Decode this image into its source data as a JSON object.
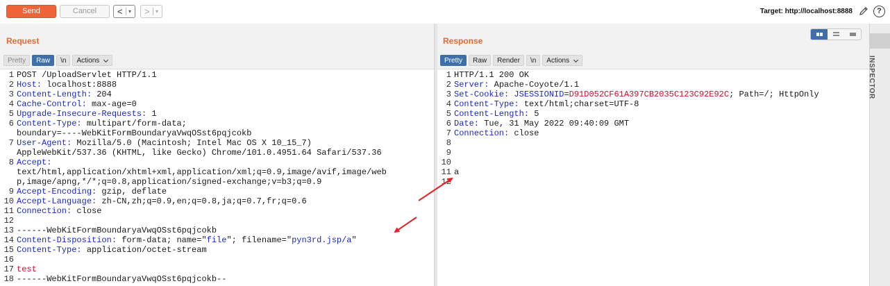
{
  "toolbar": {
    "send_label": "Send",
    "cancel_label": "Cancel",
    "back_glyph": "<",
    "fwd_glyph": ">",
    "dropdown_glyph": "▾",
    "target_label": "Target: http://localhost:8888",
    "help_glyph": "?",
    "icons": [
      "edit-icon",
      "help-icon"
    ]
  },
  "request": {
    "title": "Request",
    "tabs": {
      "pretty": "Pretty",
      "raw": "Raw",
      "newline": "\\n",
      "actions": "Actions"
    },
    "active_tab": "Raw",
    "lines": [
      {
        "n": "1",
        "parts": [
          {
            "t": "POST /UploadServlet HTTP/1.1",
            "c": ""
          }
        ]
      },
      {
        "n": "2",
        "parts": [
          {
            "t": "Host:",
            "c": "hk"
          },
          {
            "t": " localhost:8888",
            "c": ""
          }
        ]
      },
      {
        "n": "3",
        "parts": [
          {
            "t": "Content-Length:",
            "c": "hk"
          },
          {
            "t": " 204",
            "c": ""
          }
        ]
      },
      {
        "n": "4",
        "parts": [
          {
            "t": "Cache-Control:",
            "c": "hk"
          },
          {
            "t": " max-age=0",
            "c": ""
          }
        ]
      },
      {
        "n": "5",
        "parts": [
          {
            "t": "Upgrade-Insecure-Requests:",
            "c": "hk"
          },
          {
            "t": " 1",
            "c": ""
          }
        ]
      },
      {
        "n": "6",
        "parts": [
          {
            "t": "Content-Type:",
            "c": "hk"
          },
          {
            "t": " multipart/form-data;",
            "c": ""
          }
        ]
      },
      {
        "n": "",
        "parts": [
          {
            "t": "boundary=----WebKitFormBoundaryaVwqOSst6pqjcokb",
            "c": ""
          }
        ]
      },
      {
        "n": "7",
        "parts": [
          {
            "t": "User-Agent:",
            "c": "hk"
          },
          {
            "t": " Mozilla/5.0 (Macintosh; Intel Mac OS X 10_15_7)",
            "c": ""
          }
        ]
      },
      {
        "n": "",
        "parts": [
          {
            "t": "AppleWebKit/537.36 (KHTML, like Gecko) Chrome/101.0.4951.64 Safari/537.36",
            "c": ""
          }
        ]
      },
      {
        "n": "8",
        "parts": [
          {
            "t": "Accept:",
            "c": "hk"
          }
        ]
      },
      {
        "n": "",
        "parts": [
          {
            "t": "text/html,application/xhtml+xml,application/xml;q=0.9,image/avif,image/web",
            "c": ""
          }
        ]
      },
      {
        "n": "",
        "parts": [
          {
            "t": "p,image/apng,*/*;q=0.8,application/signed-exchange;v=b3;q=0.9",
            "c": ""
          }
        ]
      },
      {
        "n": "9",
        "parts": [
          {
            "t": "Accept-Encoding:",
            "c": "hk"
          },
          {
            "t": " gzip, deflate",
            "c": ""
          }
        ]
      },
      {
        "n": "10",
        "parts": [
          {
            "t": "Accept-Language:",
            "c": "hk"
          },
          {
            "t": " zh-CN,zh;q=0.9,en;q=0.8,ja;q=0.7,fr;q=0.6",
            "c": ""
          }
        ]
      },
      {
        "n": "11",
        "parts": [
          {
            "t": "Connection:",
            "c": "hk"
          },
          {
            "t": " close",
            "c": ""
          }
        ]
      },
      {
        "n": "12",
        "parts": []
      },
      {
        "n": "13",
        "parts": [
          {
            "t": "------WebKitFormBoundaryaVwqOSst6pqjcokb",
            "c": ""
          }
        ]
      },
      {
        "n": "14",
        "parts": [
          {
            "t": "Content-Disposition:",
            "c": "hk"
          },
          {
            "t": " form-data; name=\"",
            "c": ""
          },
          {
            "t": "file",
            "c": "hs"
          },
          {
            "t": "\"; filename=\"",
            "c": ""
          },
          {
            "t": "pyn3rd.jsp/a",
            "c": "hs"
          },
          {
            "t": "\"",
            "c": ""
          }
        ]
      },
      {
        "n": "15",
        "parts": [
          {
            "t": "Content-Type:",
            "c": "hk"
          },
          {
            "t": " application/octet-stream",
            "c": ""
          }
        ]
      },
      {
        "n": "16",
        "parts": []
      },
      {
        "n": "17",
        "parts": [
          {
            "t": "test",
            "c": "rv"
          }
        ]
      },
      {
        "n": "18",
        "parts": [
          {
            "t": "------WebKitFormBoundaryaVwqOSst6pqjcokb--",
            "c": ""
          }
        ]
      }
    ]
  },
  "response": {
    "title": "Response",
    "tabs": {
      "pretty": "Pretty",
      "raw": "Raw",
      "render": "Render",
      "newline": "\\n",
      "actions": "Actions"
    },
    "active_tab": "Pretty",
    "lines": [
      {
        "n": "1",
        "parts": [
          {
            "t": "HTTP/1.1 200 OK",
            "c": ""
          }
        ]
      },
      {
        "n": "2",
        "parts": [
          {
            "t": "Server:",
            "c": "hk"
          },
          {
            "t": " Apache-Coyote/1.1",
            "c": ""
          }
        ]
      },
      {
        "n": "3",
        "parts": [
          {
            "t": "Set-Cookie:",
            "c": "hk"
          },
          {
            "t": " ",
            "c": ""
          },
          {
            "t": "JSESSIONID",
            "c": "hs"
          },
          {
            "t": "=",
            "c": ""
          },
          {
            "t": "D91D052CF61A397CB2035C123C92E92C",
            "c": "rv"
          },
          {
            "t": "; Path=/; HttpOnly",
            "c": ""
          }
        ]
      },
      {
        "n": "4",
        "parts": [
          {
            "t": "Content-Type:",
            "c": "hk"
          },
          {
            "t": " text/html;charset=UTF-8",
            "c": ""
          }
        ]
      },
      {
        "n": "5",
        "parts": [
          {
            "t": "Content-Length:",
            "c": "hk"
          },
          {
            "t": " 5",
            "c": ""
          }
        ]
      },
      {
        "n": "6",
        "parts": [
          {
            "t": "Date:",
            "c": "hk"
          },
          {
            "t": " Tue, 31 May 2022 09:40:09 GMT",
            "c": ""
          }
        ]
      },
      {
        "n": "7",
        "parts": [
          {
            "t": "Connection:",
            "c": "hk"
          },
          {
            "t": " close",
            "c": ""
          }
        ]
      },
      {
        "n": "8",
        "parts": []
      },
      {
        "n": "9",
        "parts": []
      },
      {
        "n": "10",
        "parts": []
      },
      {
        "n": "11",
        "parts": [
          {
            "t": "a",
            "c": ""
          }
        ]
      },
      {
        "n": "12",
        "parts": []
      }
    ]
  },
  "inspector": {
    "label": "INSPECTOR"
  },
  "colors": {
    "accent_orange": "#ee6436",
    "tab_active_blue": "#3f6fa8",
    "header_key_blue": "#1b28c8",
    "value_red": "#c8102e",
    "arrow_red": "#e8202a"
  }
}
